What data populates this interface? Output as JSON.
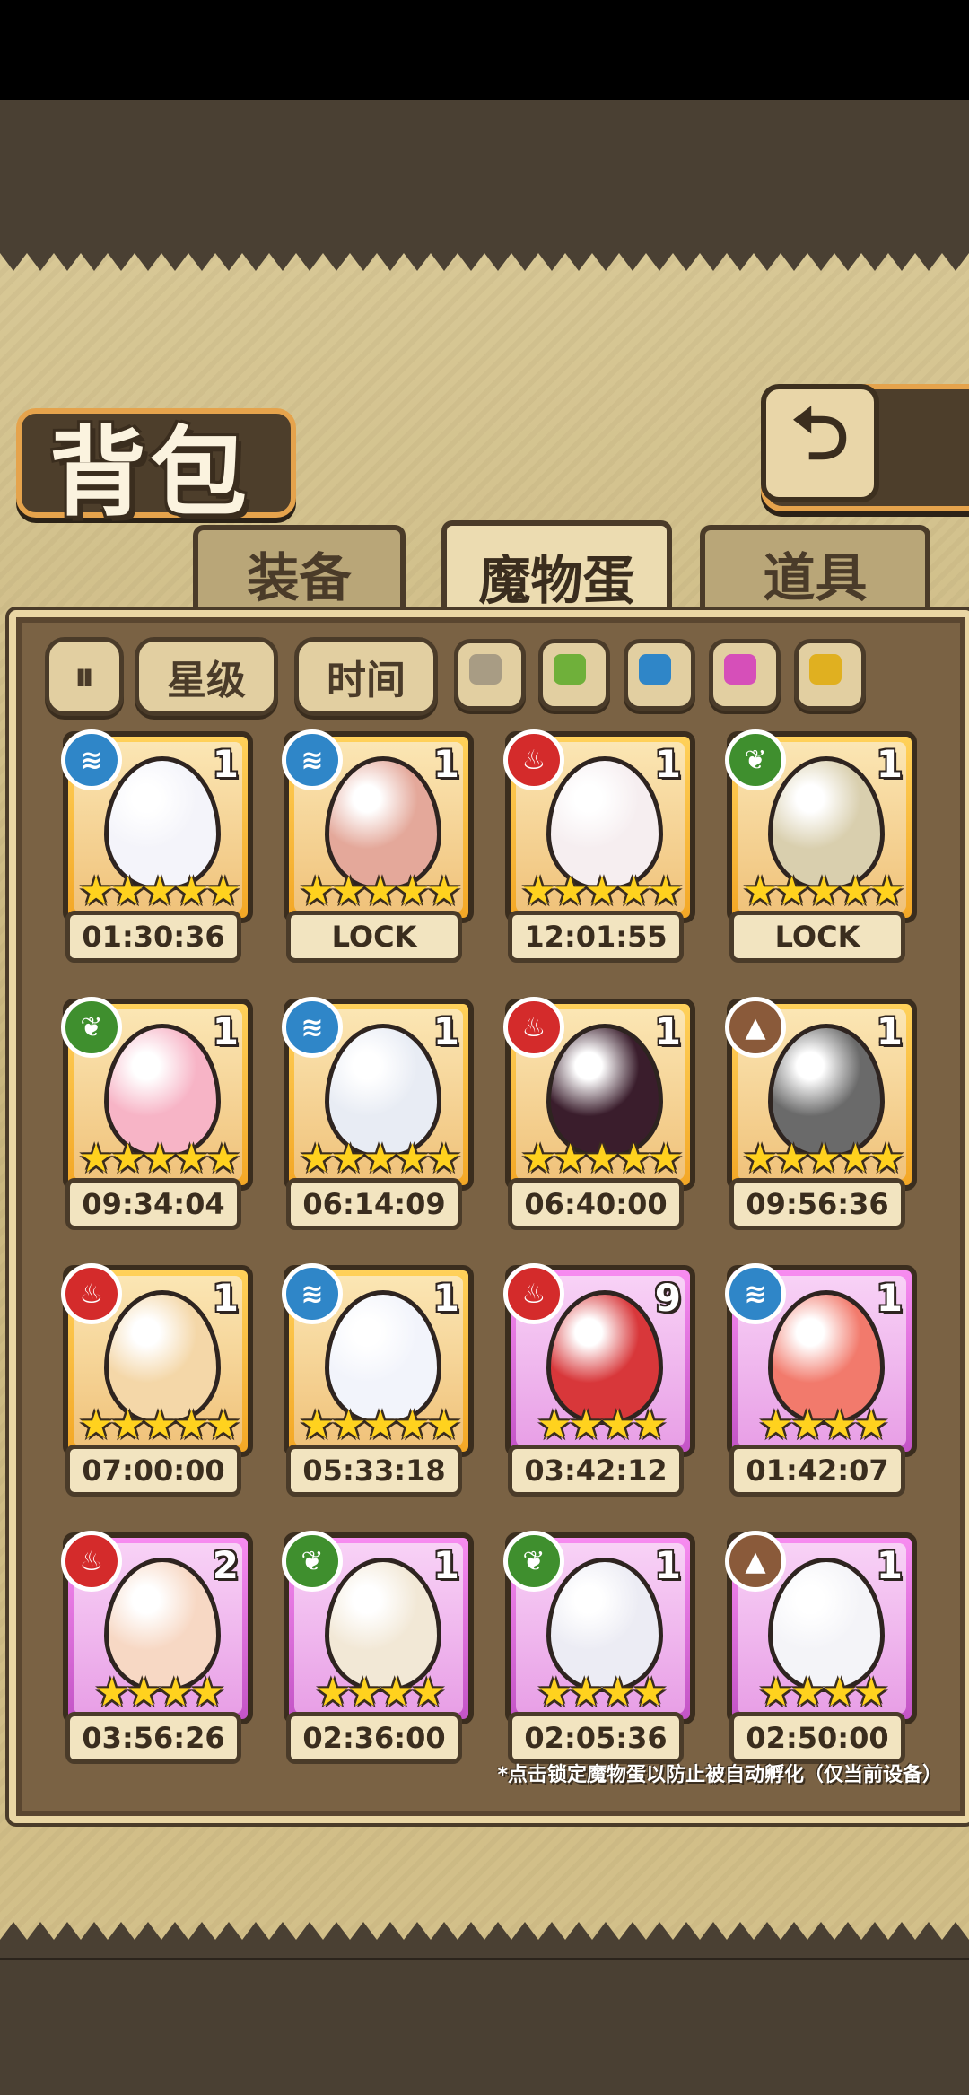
{
  "title": "背包",
  "back_icon": "return-arrow-icon",
  "tabs": [
    {
      "label": "装备",
      "active": false
    },
    {
      "label": "魔物蛋",
      "active": true
    },
    {
      "label": "道具",
      "active": false
    }
  ],
  "filters": {
    "sort_icon": "sort-toggle-icon",
    "star_label": "星级",
    "time_label": "时间",
    "swatches": [
      {
        "name": "grey",
        "color": "#a89c84"
      },
      {
        "name": "green",
        "color": "#6fb03a"
      },
      {
        "name": "blue",
        "color": "#2f86c8"
      },
      {
        "name": "pink",
        "color": "#d64fb9"
      },
      {
        "name": "gold",
        "color": "#e0b020"
      }
    ]
  },
  "eggs": [
    {
      "element": "water",
      "count": "1",
      "stars": "★★★★★",
      "timer": "01:30:36",
      "rarity": "gold",
      "color": "#f4f4fa"
    },
    {
      "element": "water",
      "count": "1",
      "stars": "★★★★★",
      "timer": "LOCK",
      "rarity": "gold",
      "color": "#e4a89a"
    },
    {
      "element": "fire",
      "count": "1",
      "stars": "★★★★★",
      "timer": "12:01:55",
      "rarity": "gold",
      "color": "#f6eef0"
    },
    {
      "element": "leaf",
      "count": "1",
      "stars": "★★★★★",
      "timer": "LOCK",
      "rarity": "gold",
      "color": "#d9cfae"
    },
    {
      "element": "leaf",
      "count": "1",
      "stars": "★★★★★",
      "timer": "09:34:04",
      "rarity": "gold",
      "color": "#f7b4c6"
    },
    {
      "element": "water",
      "count": "1",
      "stars": "★★★★★",
      "timer": "06:14:09",
      "rarity": "gold",
      "color": "#e8ecf4"
    },
    {
      "element": "fire",
      "count": "1",
      "stars": "★★★★★",
      "timer": "06:40:00",
      "rarity": "gold",
      "color": "#3a1d2c"
    },
    {
      "element": "earth",
      "count": "1",
      "stars": "★★★★★",
      "timer": "09:56:36",
      "rarity": "gold",
      "color": "#6a6a6a"
    },
    {
      "element": "fire",
      "count": "1",
      "stars": "★★★★★",
      "timer": "07:00:00",
      "rarity": "gold",
      "color": "#f4d7a8"
    },
    {
      "element": "water",
      "count": "1",
      "stars": "★★★★★",
      "timer": "05:33:18",
      "rarity": "gold",
      "color": "#f2f4fb"
    },
    {
      "element": "fire",
      "count": "9",
      "stars": "★★★★",
      "timer": "03:42:12",
      "rarity": "pink",
      "color": "#d8373a"
    },
    {
      "element": "water",
      "count": "1",
      "stars": "★★★★",
      "timer": "01:42:07",
      "rarity": "pink",
      "color": "#f27a6c"
    },
    {
      "element": "fire",
      "count": "2",
      "stars": "★★★★",
      "timer": "03:56:26",
      "rarity": "pink",
      "color": "#f7d8c4"
    },
    {
      "element": "leaf",
      "count": "1",
      "stars": "★★★★",
      "timer": "02:36:00",
      "rarity": "pink",
      "color": "#f2e8d6"
    },
    {
      "element": "leaf",
      "count": "1",
      "stars": "★★★★",
      "timer": "02:05:36",
      "rarity": "pink",
      "color": "#ececf4"
    },
    {
      "element": "earth",
      "count": "1",
      "stars": "★★★★",
      "timer": "02:50:00",
      "rarity": "pink",
      "color": "#f4f4f8"
    }
  ],
  "element_styles": {
    "water": {
      "color": "#2f86c8",
      "glyph": "≋",
      "icon": "water-element-icon"
    },
    "fire": {
      "color": "#d42b2b",
      "glyph": "♨",
      "icon": "fire-element-icon"
    },
    "leaf": {
      "color": "#3f8f2e",
      "glyph": "❦",
      "icon": "leaf-element-icon"
    },
    "earth": {
      "color": "#8a5a3a",
      "glyph": "▲",
      "icon": "earth-element-icon"
    }
  },
  "footnote": "*点击锁定魔物蛋以防止被自动孵化（仅当前设备）"
}
